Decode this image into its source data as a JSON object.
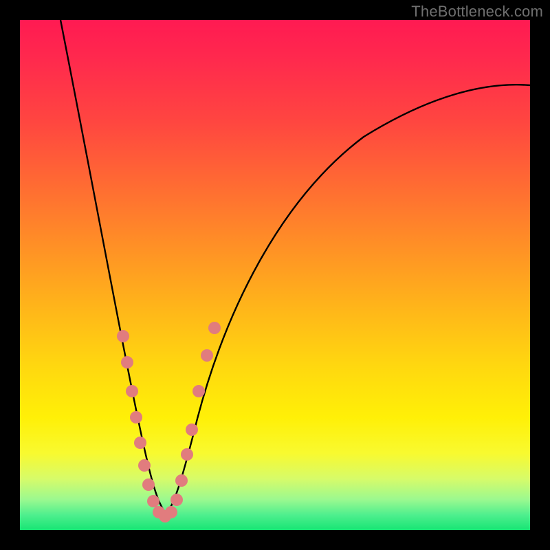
{
  "watermark": "TheBottleneck.com",
  "colors": {
    "dot": "#e17c7e",
    "curve": "#000000",
    "frame": "#000000"
  },
  "chart_data": {
    "type": "line",
    "title": "",
    "xlabel": "",
    "ylabel": "",
    "xlim": [
      0,
      100
    ],
    "ylim": [
      0,
      100
    ],
    "series": [
      {
        "name": "left-branch",
        "x": [
          8,
          10,
          12,
          14,
          16,
          18,
          20,
          21,
          22,
          23,
          24,
          25,
          26,
          27,
          28
        ],
        "y": [
          100,
          90,
          80,
          70,
          60,
          49,
          38,
          32,
          27,
          22,
          17,
          12,
          8,
          5,
          3
        ]
      },
      {
        "name": "right-branch",
        "x": [
          28,
          29,
          30,
          31,
          32,
          34,
          36,
          38,
          42,
          48,
          56,
          66,
          80,
          100
        ],
        "y": [
          3,
          5,
          8,
          12,
          17,
          26,
          34,
          41,
          53,
          64,
          73,
          80,
          84,
          86
        ]
      }
    ],
    "scatter_overlay": {
      "name": "highlighted-points",
      "points": [
        {
          "x": 20.0,
          "y": 38
        },
        {
          "x": 21.0,
          "y": 32
        },
        {
          "x": 22.0,
          "y": 26
        },
        {
          "x": 22.8,
          "y": 21
        },
        {
          "x": 23.6,
          "y": 16
        },
        {
          "x": 24.4,
          "y": 12
        },
        {
          "x": 25.2,
          "y": 8
        },
        {
          "x": 26.0,
          "y": 5
        },
        {
          "x": 27.0,
          "y": 3
        },
        {
          "x": 28.0,
          "y": 3
        },
        {
          "x": 29.0,
          "y": 3
        },
        {
          "x": 30.0,
          "y": 5
        },
        {
          "x": 31.0,
          "y": 9
        },
        {
          "x": 32.0,
          "y": 15
        },
        {
          "x": 33.0,
          "y": 20
        },
        {
          "x": 34.5,
          "y": 28
        },
        {
          "x": 36.0,
          "y": 35
        },
        {
          "x": 37.5,
          "y": 40
        }
      ]
    }
  }
}
